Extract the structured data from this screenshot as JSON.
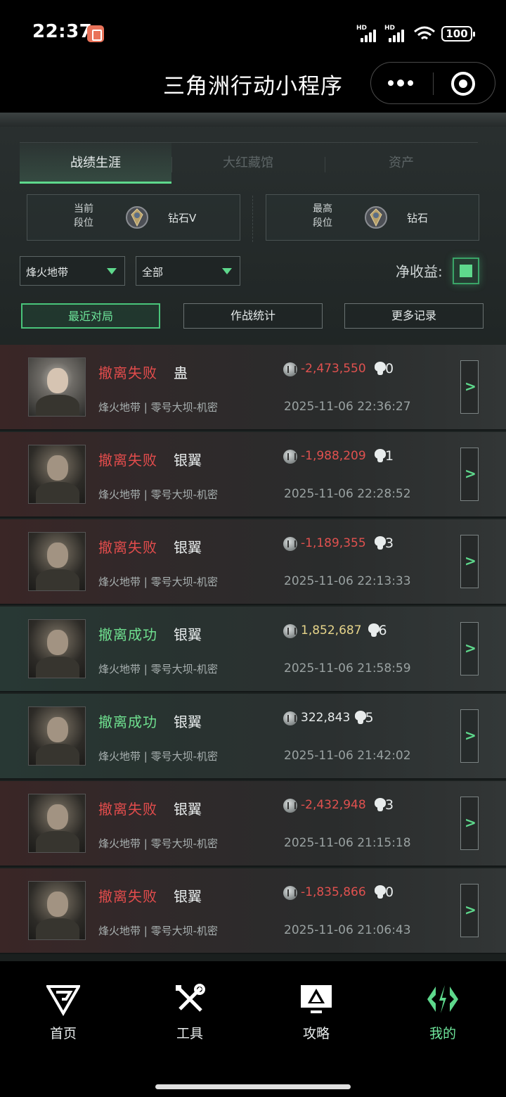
{
  "status_bar": {
    "time": "22:37",
    "signal1": "HD",
    "signal2": "HD",
    "battery": "100"
  },
  "nav": {
    "title": "三角洲行动小程序"
  },
  "tabs": [
    {
      "label": "战绩生涯",
      "active": true
    },
    {
      "label": "大红藏馆",
      "active": false
    },
    {
      "label": "资产",
      "active": false
    }
  ],
  "rank": {
    "current": {
      "label_line1": "当前",
      "label_line2": "段位",
      "value": "钻石V"
    },
    "highest": {
      "label_line1": "最高",
      "label_line2": "段位",
      "value": "钻石"
    }
  },
  "filters": {
    "mode": "烽火地带",
    "scope": "全部",
    "net_profit_label": "净收益:",
    "net_profit_enabled": true
  },
  "sub_tabs": [
    {
      "label": "最近对局",
      "active": true
    },
    {
      "label": "作战统计",
      "active": false
    },
    {
      "label": "更多记录",
      "active": false
    }
  ],
  "records": [
    {
      "result": "撤离失败",
      "status": "fail",
      "operator": "蛊",
      "value": "-2,473,550",
      "sign": "neg",
      "kills": "0",
      "map": "烽火地带 | 零号大坝-机密",
      "time": "2025-11-06 22:36:27",
      "avatar": "female"
    },
    {
      "result": "撤离失败",
      "status": "fail",
      "operator": "银翼",
      "value": "-1,988,209",
      "sign": "neg",
      "kills": "1",
      "map": "烽火地带 | 零号大坝-机密",
      "time": "2025-11-06 22:28:52",
      "avatar": "male"
    },
    {
      "result": "撤离失败",
      "status": "fail",
      "operator": "银翼",
      "value": "-1,189,355",
      "sign": "neg",
      "kills": "3",
      "map": "烽火地带 | 零号大坝-机密",
      "time": "2025-11-06 22:13:33",
      "avatar": "male"
    },
    {
      "result": "撤离成功",
      "status": "success",
      "operator": "银翼",
      "value": "1,852,687",
      "sign": "pos",
      "kills": "6",
      "map": "烽火地带 | 零号大坝-机密",
      "time": "2025-11-06 21:58:59",
      "avatar": "male"
    },
    {
      "result": "撤离成功",
      "status": "success",
      "operator": "银翼",
      "value": "322,843",
      "sign": "neu",
      "kills": "5",
      "map": "烽火地带 | 零号大坝-机密",
      "time": "2025-11-06 21:42:02",
      "avatar": "male"
    },
    {
      "result": "撤离失败",
      "status": "fail",
      "operator": "银翼",
      "value": "-2,432,948",
      "sign": "neg",
      "kills": "3",
      "map": "烽火地带 | 零号大坝-机密",
      "time": "2025-11-06 21:15:18",
      "avatar": "male"
    },
    {
      "result": "撤离失败",
      "status": "fail",
      "operator": "银翼",
      "value": "-1,835,866",
      "sign": "neg",
      "kills": "0",
      "map": "烽火地带 | 零号大坝-机密",
      "time": "2025-11-06 21:06:43",
      "avatar": "male"
    }
  ],
  "tabbar": [
    {
      "label": "首页",
      "icon": "home-icon",
      "active": false
    },
    {
      "label": "工具",
      "icon": "tools-icon",
      "active": false
    },
    {
      "label": "攻略",
      "icon": "guide-icon",
      "active": false
    },
    {
      "label": "我的",
      "icon": "profile-icon",
      "active": true
    }
  ],
  "colors": {
    "accent": "#5ed88c",
    "fail": "#e24c4c",
    "success": "#6fe08f",
    "positive_value": "#e6d48a"
  }
}
